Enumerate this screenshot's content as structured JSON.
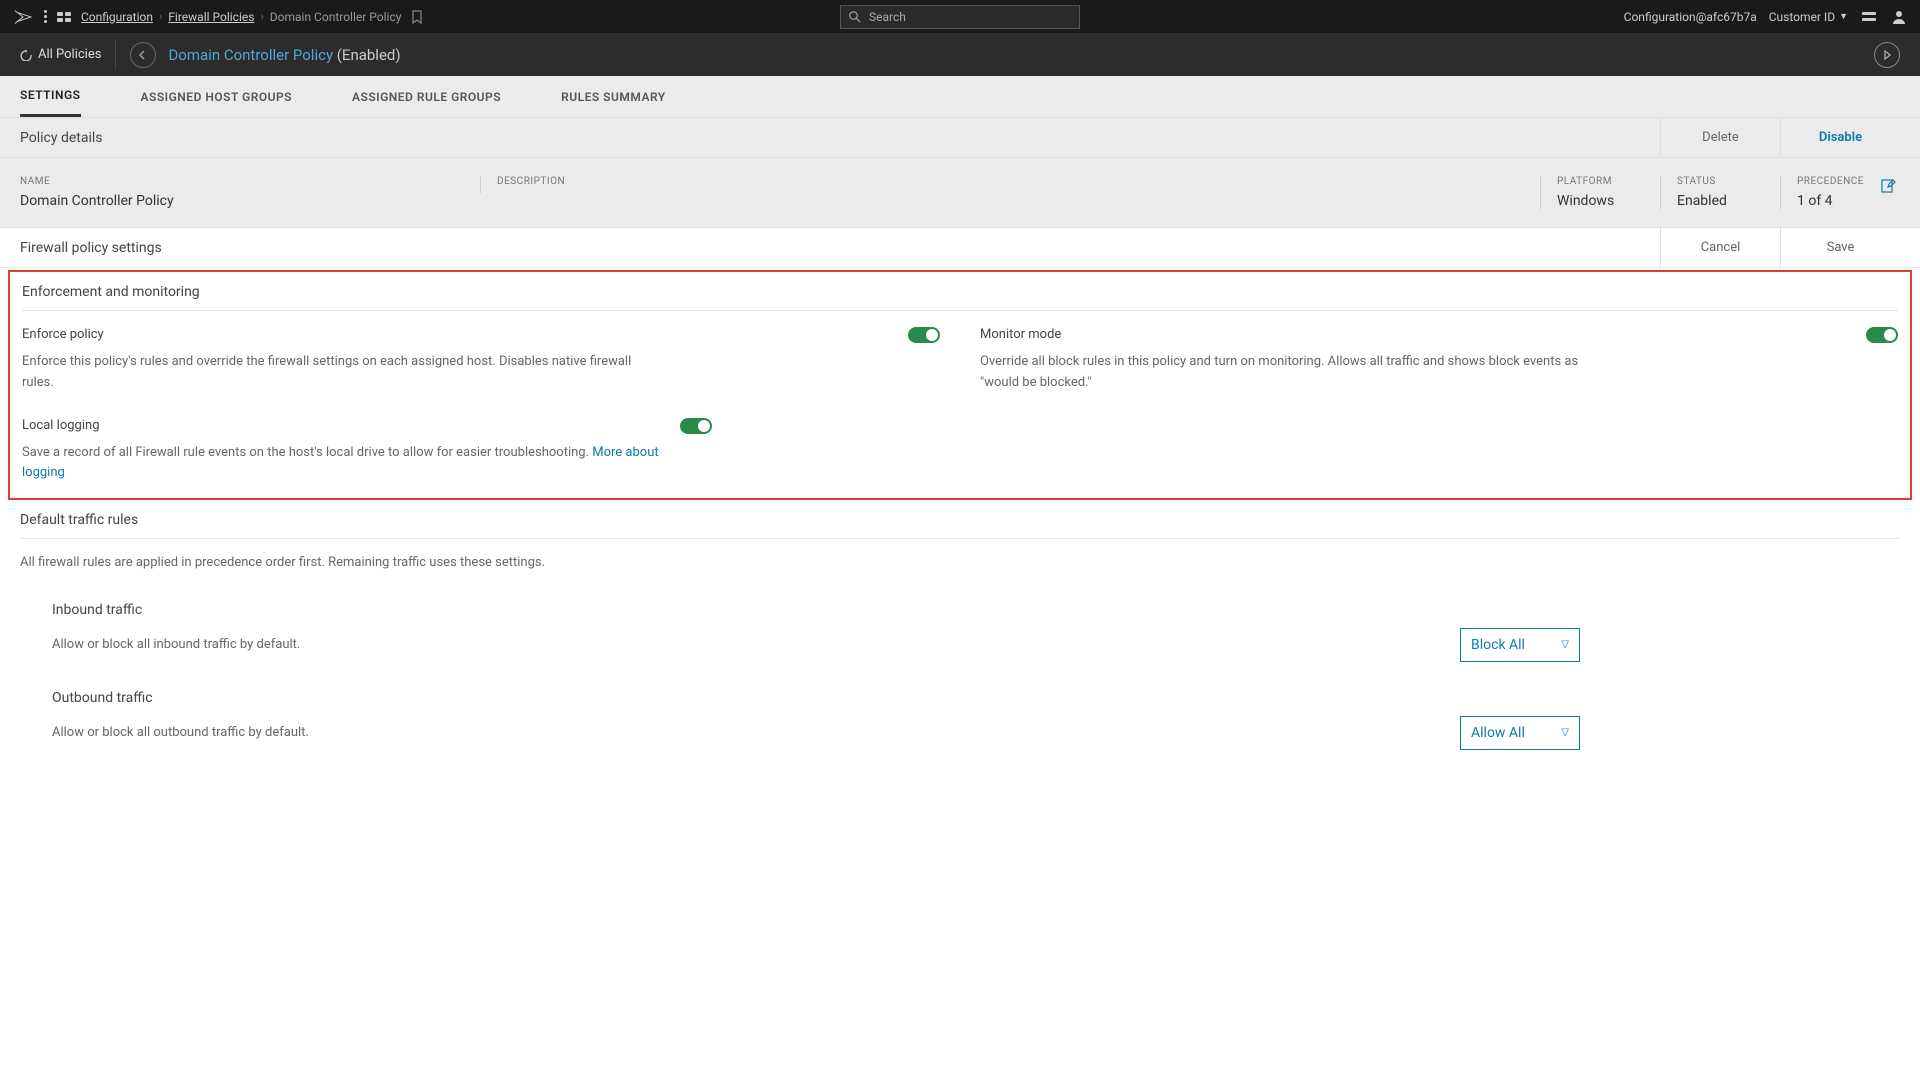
{
  "topbar": {
    "breadcrumb": {
      "configuration": "Configuration",
      "firewall_policies": "Firewall Policies",
      "current": "Domain Controller Policy"
    },
    "search_placeholder": "Search",
    "config_email": "Configuration@afc67b7a",
    "customer_id_label": "Customer ID"
  },
  "subbar": {
    "all_policies": "All Policies",
    "policy_name": "Domain Controller Policy",
    "policy_status": "(Enabled)"
  },
  "tabs": {
    "settings": "SETTINGS",
    "assigned_host_groups": "ASSIGNED HOST GROUPS",
    "assigned_rule_groups": "ASSIGNED RULE GROUPS",
    "rules_summary": "RULES SUMMARY"
  },
  "details": {
    "header_title": "Policy details",
    "delete": "Delete",
    "disable": "Disable",
    "name_label": "NAME",
    "name_value": "Domain Controller Policy",
    "desc_label": "DESCRIPTION",
    "desc_value": "",
    "platform_label": "PLATFORM",
    "platform_value": "Windows",
    "status_label": "STATUS",
    "status_value": "Enabled",
    "precedence_label": "PRECEDENCE",
    "precedence_value": "1 of 4"
  },
  "settings": {
    "header_title": "Firewall policy settings",
    "cancel": "Cancel",
    "save": "Save",
    "enforcement_title": "Enforcement and monitoring",
    "enforce": {
      "label": "Enforce policy",
      "desc": "Enforce this policy's rules and override the firewall settings on each assigned host. Disables native firewall rules."
    },
    "monitor": {
      "label": "Monitor mode",
      "desc": "Override all block rules in this policy and turn on monitoring. Allows all traffic and shows block events as \"would be blocked.\""
    },
    "logging": {
      "label": "Local logging",
      "desc": "Save a record of all Firewall rule events on the host's local drive to allow for easier troubleshooting. ",
      "link": "More about logging"
    }
  },
  "default_traffic": {
    "title": "Default traffic rules",
    "desc": "All firewall rules are applied in precedence order first. Remaining traffic uses these settings.",
    "inbound": {
      "title": "Inbound traffic",
      "desc": "Allow or block all inbound traffic by default.",
      "value": "Block All"
    },
    "outbound": {
      "title": "Outbound traffic",
      "desc": "Allow or block all outbound traffic by default.",
      "value": "Allow All"
    }
  }
}
